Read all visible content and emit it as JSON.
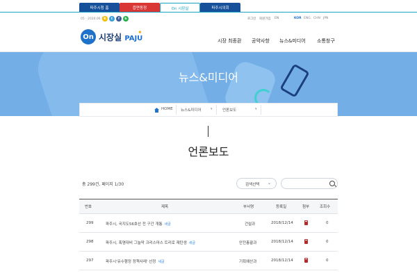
{
  "site_tabs": [
    "파주시청 홈",
    "읍면동정",
    "On 시장실",
    "파주시의회"
  ],
  "util": {
    "date": "05 · 2020.06 현재",
    "sns": [
      "K",
      "t",
      "f",
      "b"
    ],
    "links": [
      "로그인",
      "회원가입",
      "EN"
    ],
    "langs": [
      "KOR",
      "ENG",
      "CHN",
      "JPN"
    ]
  },
  "logo": {
    "on": "On",
    "text": "시장실",
    "paju": "PAJU"
  },
  "nav": [
    "시장 최종환",
    "공약사항",
    "뉴스&미디어",
    "소통창구"
  ],
  "banner": {
    "title": "뉴스&미디어"
  },
  "breadcrumb": {
    "home": "HOME",
    "level1": "뉴스&미디어",
    "level2": "언론보도"
  },
  "page_title": "언론보도",
  "list": {
    "total": "총 299건, 페이지 1/30",
    "select": "검색선택",
    "search_placeholder": ""
  },
  "table": {
    "headers": [
      "번호",
      "제목",
      "부서명",
      "등록일",
      "첨부",
      "조회수"
    ],
    "rows": [
      {
        "num": "299",
        "title": "파주시, 국지도56호선 전 구간 개통",
        "badge": "새글",
        "dept": "건설과",
        "date": "2018/12/14",
        "views": "0"
      },
      {
        "num": "298",
        "title": "파주시, 폭염대비 그늘막 크리스마스 트리로 재탄생",
        "badge": "새글",
        "dept": "안전총괄과",
        "date": "2018/12/14",
        "views": "0"
      },
      {
        "num": "297",
        "title": "파주시'유수행정 정책사례' 선정",
        "badge": "새글",
        "dept": "기획예산과",
        "date": "2018/12/14",
        "views": "0"
      }
    ]
  },
  "colors": {
    "accent": "#1f72c9",
    "banner": "#73aee6",
    "tab_red": "#d93636",
    "tab_blue": "#16509a"
  }
}
